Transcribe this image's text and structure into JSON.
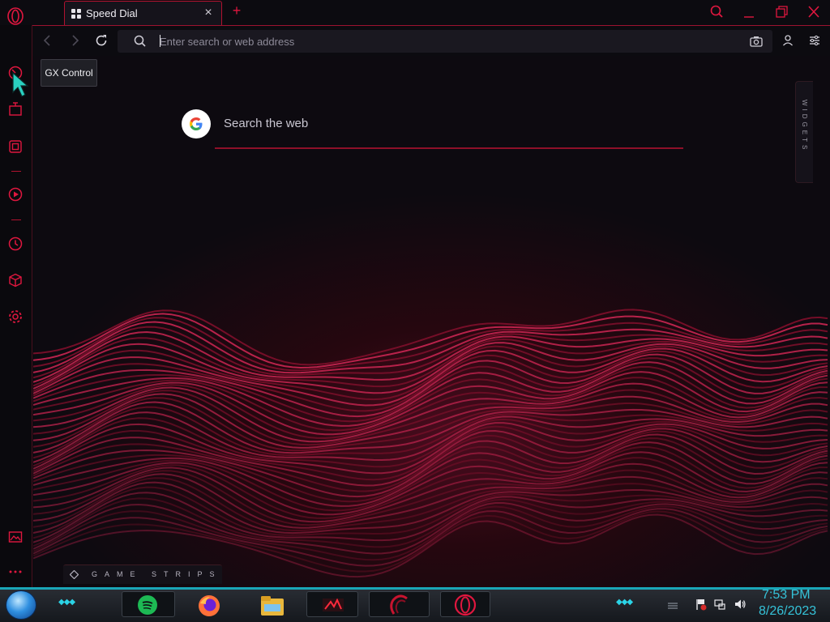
{
  "tab": {
    "title": "Speed Dial"
  },
  "address_bar": {
    "placeholder": "Enter search or web address"
  },
  "tooltip": {
    "text": "GX Control"
  },
  "speed_dial": {
    "search_label": "Search the web"
  },
  "widgets": {
    "label": "WIDGETS"
  },
  "game_strips": {
    "label": "GAME STRIPS"
  },
  "taskbar": {
    "time": "7:53 PM",
    "date": "8/26/2023"
  },
  "icons": {
    "opera_menu": "opera-logo-icon",
    "sidebar": [
      "gx-control-icon",
      "twitch-icon",
      "gx-cleaner-icon",
      "player-icon",
      "history-icon",
      "extensions-icon",
      "settings-icon",
      "wallpaper-icon",
      "more-icon"
    ],
    "toolbar": [
      "back-icon",
      "forward-icon",
      "reload-icon",
      "search-icon",
      "camera-icon",
      "account-icon",
      "easy-setup-icon"
    ],
    "taskbar_apps": [
      "spotify-icon",
      "firefox-icon",
      "file-explorer-icon",
      "media-app-icon",
      "opera-gx-icon",
      "opera-icon"
    ]
  },
  "colors": {
    "accent": "#e0173f",
    "taskbar_accent": "#1aa6b7",
    "clock": "#35c2d8"
  }
}
